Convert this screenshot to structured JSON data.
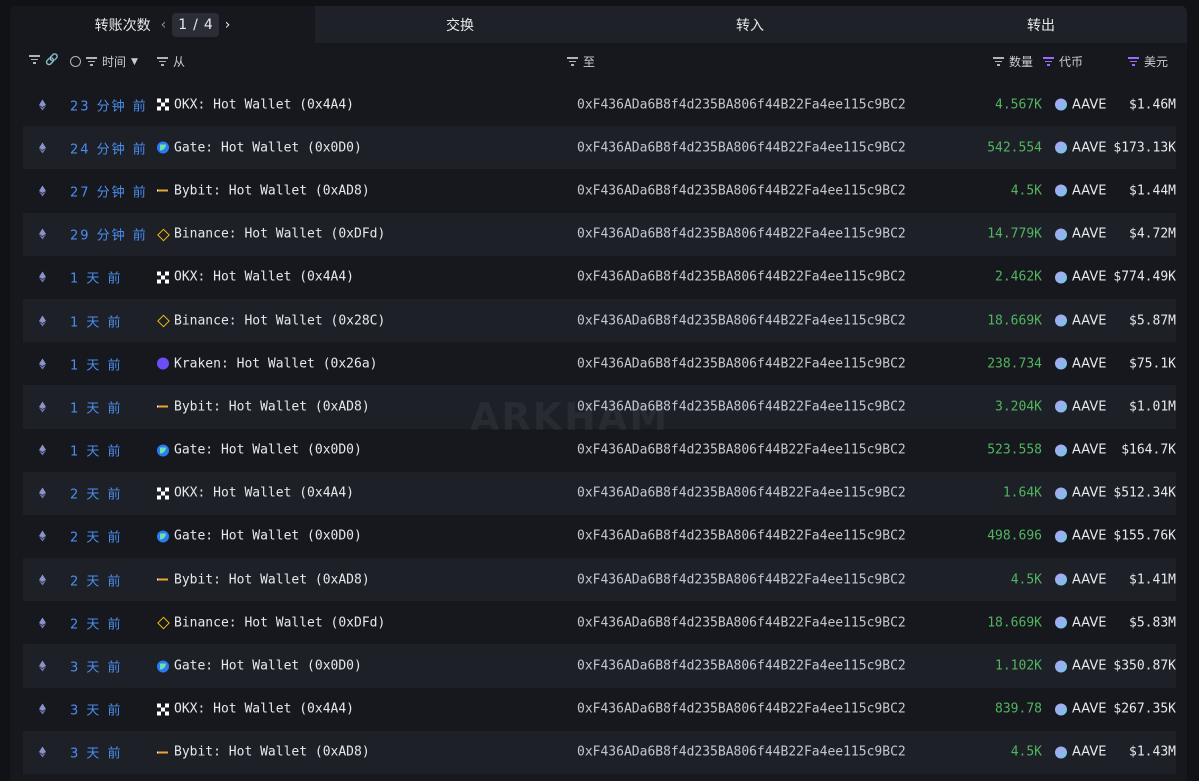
{
  "tabs": {
    "transfers_label": "转账次数",
    "page_current": "1",
    "page_sep": "/",
    "page_total": "4",
    "swaps_label": "交换",
    "inflow_label": "转入",
    "outflow_label": "转出"
  },
  "header": {
    "time": "时间",
    "from": "从",
    "to": "至",
    "amount": "数量",
    "token": "代币",
    "usd": "美元"
  },
  "watermark": "ARKHAM",
  "rows": [
    {
      "time": "23 分钟 前",
      "entity": "okx",
      "from": "OKX: Hot Wallet (0x4A4)",
      "to": "0xF436ADa6B8f4d235BA806f44B22Fa4ee115c9BC2",
      "amount": "4.567K",
      "token": "AAVE",
      "usd": "$1.46M"
    },
    {
      "time": "24 分钟 前",
      "entity": "gate",
      "from": "Gate: Hot Wallet (0x0D0)",
      "to": "0xF436ADa6B8f4d235BA806f44B22Fa4ee115c9BC2",
      "amount": "542.554",
      "token": "AAVE",
      "usd": "$173.13K"
    },
    {
      "time": "27 分钟 前",
      "entity": "bybit",
      "from": "Bybit: Hot Wallet (0xAD8)",
      "to": "0xF436ADa6B8f4d235BA806f44B22Fa4ee115c9BC2",
      "amount": "4.5K",
      "token": "AAVE",
      "usd": "$1.44M"
    },
    {
      "time": "29 分钟 前",
      "entity": "binance",
      "from": "Binance: Hot Wallet (0xDFd)",
      "to": "0xF436ADa6B8f4d235BA806f44B22Fa4ee115c9BC2",
      "amount": "14.779K",
      "token": "AAVE",
      "usd": "$4.72M"
    },
    {
      "time": "1 天 前",
      "entity": "okx",
      "from": "OKX: Hot Wallet (0x4A4)",
      "to": "0xF436ADa6B8f4d235BA806f44B22Fa4ee115c9BC2",
      "amount": "2.462K",
      "token": "AAVE",
      "usd": "$774.49K"
    },
    {
      "time": "1 天 前",
      "entity": "binance",
      "from": "Binance: Hot Wallet (0x28C)",
      "to": "0xF436ADa6B8f4d235BA806f44B22Fa4ee115c9BC2",
      "amount": "18.669K",
      "token": "AAVE",
      "usd": "$5.87M"
    },
    {
      "time": "1 天 前",
      "entity": "kraken",
      "from": "Kraken: Hot Wallet (0x26a)",
      "to": "0xF436ADa6B8f4d235BA806f44B22Fa4ee115c9BC2",
      "amount": "238.734",
      "token": "AAVE",
      "usd": "$75.1K"
    },
    {
      "time": "1 天 前",
      "entity": "bybit",
      "from": "Bybit: Hot Wallet (0xAD8)",
      "to": "0xF436ADa6B8f4d235BA806f44B22Fa4ee115c9BC2",
      "amount": "3.204K",
      "token": "AAVE",
      "usd": "$1.01M"
    },
    {
      "time": "1 天 前",
      "entity": "gate",
      "from": "Gate: Hot Wallet (0x0D0)",
      "to": "0xF436ADa6B8f4d235BA806f44B22Fa4ee115c9BC2",
      "amount": "523.558",
      "token": "AAVE",
      "usd": "$164.7K"
    },
    {
      "time": "2 天 前",
      "entity": "okx",
      "from": "OKX: Hot Wallet (0x4A4)",
      "to": "0xF436ADa6B8f4d235BA806f44B22Fa4ee115c9BC2",
      "amount": "1.64K",
      "token": "AAVE",
      "usd": "$512.34K"
    },
    {
      "time": "2 天 前",
      "entity": "gate",
      "from": "Gate: Hot Wallet (0x0D0)",
      "to": "0xF436ADa6B8f4d235BA806f44B22Fa4ee115c9BC2",
      "amount": "498.696",
      "token": "AAVE",
      "usd": "$155.76K"
    },
    {
      "time": "2 天 前",
      "entity": "bybit",
      "from": "Bybit: Hot Wallet (0xAD8)",
      "to": "0xF436ADa6B8f4d235BA806f44B22Fa4ee115c9BC2",
      "amount": "4.5K",
      "token": "AAVE",
      "usd": "$1.41M"
    },
    {
      "time": "2 天 前",
      "entity": "binance",
      "from": "Binance: Hot Wallet (0xDFd)",
      "to": "0xF436ADa6B8f4d235BA806f44B22Fa4ee115c9BC2",
      "amount": "18.669K",
      "token": "AAVE",
      "usd": "$5.83M"
    },
    {
      "time": "3 天 前",
      "entity": "gate",
      "from": "Gate: Hot Wallet (0x0D0)",
      "to": "0xF436ADa6B8f4d235BA806f44B22Fa4ee115c9BC2",
      "amount": "1.102K",
      "token": "AAVE",
      "usd": "$350.87K"
    },
    {
      "time": "3 天 前",
      "entity": "okx",
      "from": "OKX: Hot Wallet (0x4A4)",
      "to": "0xF436ADa6B8f4d235BA806f44B22Fa4ee115c9BC2",
      "amount": "839.78",
      "token": "AAVE",
      "usd": "$267.35K"
    },
    {
      "time": "3 天 前",
      "entity": "bybit",
      "from": "Bybit: Hot Wallet (0xAD8)",
      "to": "0xF436ADa6B8f4d235BA806f44B22Fa4ee115c9BC2",
      "amount": "4.5K",
      "token": "AAVE",
      "usd": "$1.43M"
    }
  ]
}
